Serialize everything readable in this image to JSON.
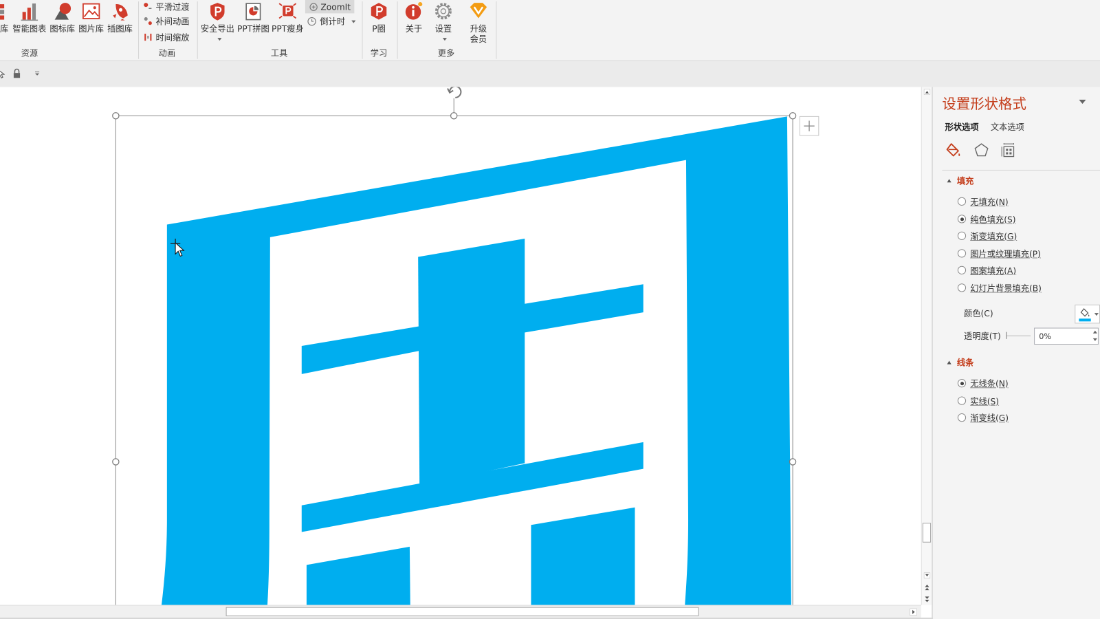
{
  "colors": {
    "accent": "#c43e1c",
    "shape_fill": "#00aeef",
    "ribbon_icon": "#d13c2c",
    "upgrade_icon": "#f39c12"
  },
  "ribbon": {
    "resources": {
      "label": "资源",
      "buttons": [
        {
          "label": "库",
          "icon": "grid-icon"
        },
        {
          "label": "智能图表",
          "icon": "bar-chart-icon"
        },
        {
          "label": "图标库",
          "icon": "shapes-icon"
        },
        {
          "label": "图片库",
          "icon": "picture-icon"
        },
        {
          "label": "插图库",
          "icon": "rocket-icon"
        }
      ]
    },
    "animation": {
      "label": "动画",
      "items": [
        {
          "label": "平滑过渡",
          "icon": "smooth-transition-icon"
        },
        {
          "label": "补间动画",
          "icon": "tween-icon"
        },
        {
          "label": "时间缩放",
          "icon": "time-scale-icon"
        }
      ]
    },
    "tools": {
      "label": "工具",
      "buttons": [
        {
          "label": "安全导出",
          "icon": "shield-p-icon"
        },
        {
          "label": "PPT拼图",
          "icon": "collage-icon"
        },
        {
          "label": "PPT瘦身",
          "icon": "slim-icon"
        }
      ],
      "zoomit": "ZoomIt",
      "countdown": "倒计时"
    },
    "learn": {
      "label": "学习",
      "pcircle": "P圈"
    },
    "more": {
      "label": "更多",
      "about": "关于",
      "settings": "设置",
      "upgrade": [
        "升级",
        "会员"
      ]
    }
  },
  "panel": {
    "title": "设置形状格式",
    "tabs": [
      {
        "label": "形状选项",
        "active": true
      },
      {
        "label": "文本选项",
        "active": false
      }
    ],
    "fill": {
      "heading": "填充",
      "options": [
        {
          "label": "无填充(N)",
          "checked": false
        },
        {
          "label": "纯色填充(S)",
          "checked": true
        },
        {
          "label": "渐变填充(G)",
          "checked": false
        },
        {
          "label": "图片或纹理填充(P)",
          "checked": false
        },
        {
          "label": "图案填充(A)",
          "checked": false
        },
        {
          "label": "幻灯片背景填充(B)",
          "checked": false
        }
      ],
      "color_label": "颜色(C)",
      "transparency_label": "透明度(T)",
      "transparency_value": "0%"
    },
    "line": {
      "heading": "线条",
      "options": [
        {
          "label": "无线条(N)",
          "checked": true
        },
        {
          "label": "实线(S)",
          "checked": false
        },
        {
          "label": "渐变线(G)",
          "checked": false
        }
      ]
    }
  }
}
